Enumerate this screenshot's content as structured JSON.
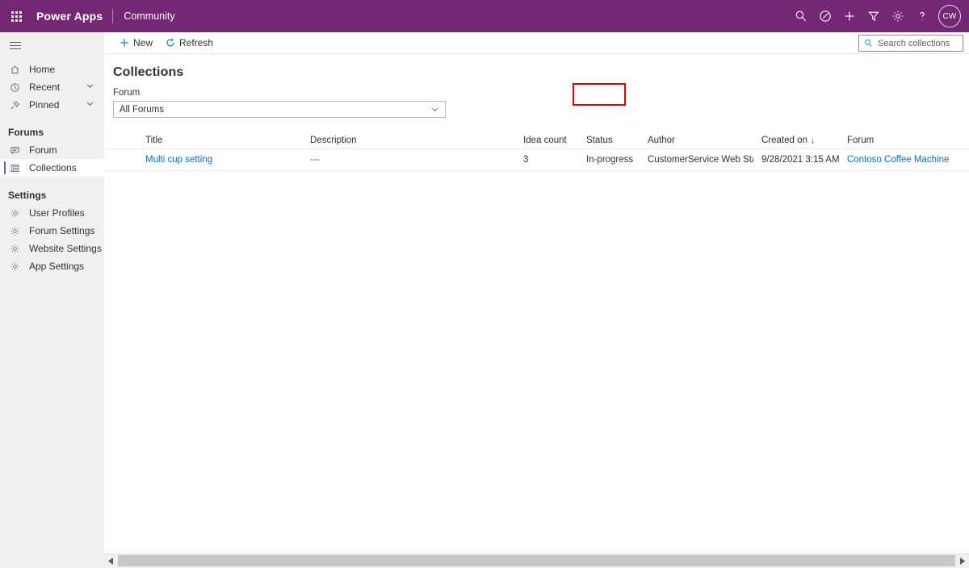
{
  "header": {
    "waffle_icon": "app-launcher-icon",
    "brand": "Power Apps",
    "app_name": "Community",
    "icons": [
      {
        "name": "search-icon",
        "glyph": "search"
      },
      {
        "name": "environment-icon",
        "glyph": "environment"
      },
      {
        "name": "add-icon",
        "glyph": "plus"
      },
      {
        "name": "filter-icon",
        "glyph": "filter"
      },
      {
        "name": "settings-gear-icon",
        "glyph": "gear"
      },
      {
        "name": "help-icon",
        "glyph": "question"
      }
    ],
    "avatar_initials": "CW"
  },
  "sidebar": {
    "hamburger_label": "Site map",
    "items": [
      {
        "label": "Home",
        "icon": "home-icon",
        "expandable": false,
        "selected": false
      },
      {
        "label": "Recent",
        "icon": "clock-icon",
        "expandable": true,
        "selected": false
      },
      {
        "label": "Pinned",
        "icon": "pin-icon",
        "expandable": true,
        "selected": false
      }
    ],
    "groups": [
      {
        "title": "Forums",
        "items": [
          {
            "label": "Forum",
            "icon": "forum-icon",
            "selected": false
          },
          {
            "label": "Collections",
            "icon": "collections-icon",
            "selected": true
          }
        ]
      },
      {
        "title": "Settings",
        "items": [
          {
            "label": "User Profiles",
            "icon": "gear-icon",
            "selected": false
          },
          {
            "label": "Forum Settings",
            "icon": "gear-icon",
            "selected": false
          },
          {
            "label": "Website Settings",
            "icon": "gear-icon",
            "selected": false
          },
          {
            "label": "App Settings",
            "icon": "gear-icon",
            "selected": false
          }
        ]
      }
    ]
  },
  "command_bar": {
    "new_label": "New",
    "refresh_label": "Refresh",
    "search_placeholder": "Search collections",
    "search_value": ""
  },
  "page": {
    "title": "Collections",
    "filter_label": "Forum",
    "filter_value": "All Forums"
  },
  "grid": {
    "columns": [
      {
        "key": "title",
        "label": "Title"
      },
      {
        "key": "description",
        "label": "Description"
      },
      {
        "key": "idea_count",
        "label": "Idea count"
      },
      {
        "key": "status",
        "label": "Status"
      },
      {
        "key": "author",
        "label": "Author"
      },
      {
        "key": "created_on",
        "label": "Created on",
        "sorted": true,
        "sort_arrow": "↓"
      },
      {
        "key": "forum",
        "label": "Forum"
      }
    ],
    "rows": [
      {
        "title": "Multi cup setting",
        "description": "---",
        "idea_count": "3",
        "status": "In-progress",
        "author": "CustomerService Web Staging",
        "created_on": "9/28/2021 3:15 AM",
        "forum": "Contoso Coffee Machine"
      }
    ]
  },
  "colors": {
    "brand_purple": "#742774",
    "accent_blue": "#0078d4",
    "link_blue": "#0f6cbd",
    "selected_bar": "#5c64c5",
    "highlight_red": "#e60000"
  }
}
